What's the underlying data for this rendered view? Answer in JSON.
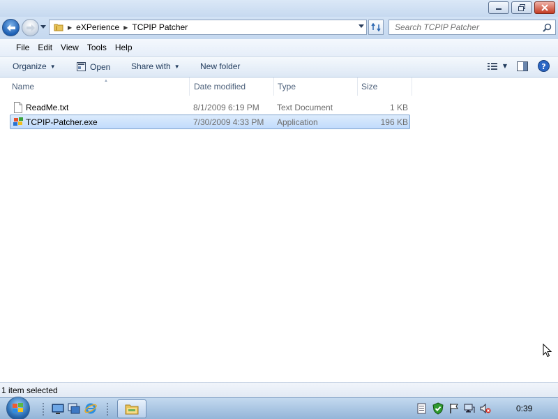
{
  "address": {
    "crumbs": [
      "eXPerience",
      "TCPIP Patcher"
    ]
  },
  "search": {
    "placeholder": "Search TCPIP Patcher"
  },
  "menu": {
    "file": "File",
    "edit": "Edit",
    "view": "View",
    "tools": "Tools",
    "help": "Help"
  },
  "commands": {
    "organize": "Organize",
    "open": "Open",
    "share_with": "Share with",
    "new_folder": "New folder"
  },
  "columns": {
    "name": "Name",
    "date": "Date modified",
    "type": "Type",
    "size": "Size"
  },
  "files": [
    {
      "name": "ReadMe.txt",
      "date": "8/1/2009 6:19 PM",
      "type": "Text Document",
      "size": "1 KB",
      "icon": "text-file-icon",
      "selected": false
    },
    {
      "name": "TCPIP-Patcher.exe",
      "date": "7/30/2009 4:33 PM",
      "type": "Application",
      "size": "196 KB",
      "icon": "application-icon",
      "selected": true
    }
  ],
  "status": {
    "text": "1 item selected"
  },
  "taskbar": {
    "clock": "0:39"
  }
}
